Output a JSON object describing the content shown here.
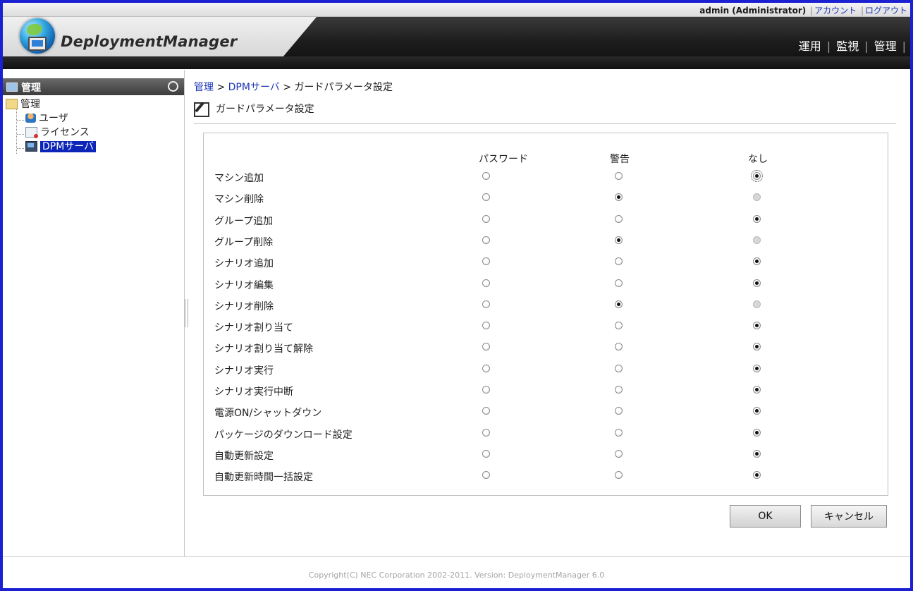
{
  "header": {
    "user": "admin (Administrator)",
    "links": [
      "アカウント",
      "ログアウト"
    ],
    "logo_text": "DeploymentManager",
    "nav": [
      "運用",
      "監視",
      "管理"
    ]
  },
  "sidebar": {
    "title": "管理",
    "tree": [
      {
        "label": "管理"
      },
      {
        "label": "ユーザ"
      },
      {
        "label": "ライセンス"
      },
      {
        "label": "DPMサーバ",
        "selected": true
      }
    ]
  },
  "breadcrumb": {
    "items": [
      "管理",
      "DPMサーバ"
    ],
    "separator": ">",
    "current": "ガードパラメータ設定"
  },
  "page_title": "ガードパラメータ設定",
  "form": {
    "columns": [
      "パスワード",
      "警告",
      "なし"
    ],
    "rows": [
      {
        "label": "マシン追加",
        "selected": "なし"
      },
      {
        "label": "マシン削除",
        "selected": "警告",
        "none_disabled": true
      },
      {
        "label": "グループ追加",
        "selected": "なし"
      },
      {
        "label": "グループ削除",
        "selected": "警告",
        "none_disabled": true
      },
      {
        "label": "シナリオ追加",
        "selected": "なし"
      },
      {
        "label": "シナリオ編集",
        "selected": "なし"
      },
      {
        "label": "シナリオ削除",
        "selected": "警告",
        "none_disabled": true
      },
      {
        "label": "シナリオ割り当て",
        "selected": "なし"
      },
      {
        "label": "シナリオ割り当て解除",
        "selected": "なし"
      },
      {
        "label": "シナリオ実行",
        "selected": "なし"
      },
      {
        "label": "シナリオ実行中断",
        "selected": "なし"
      },
      {
        "label": "電源ON/シャットダウン",
        "selected": "なし"
      },
      {
        "label": "パッケージのダウンロード設定",
        "selected": "なし"
      },
      {
        "label": "自動更新設定",
        "selected": "なし"
      },
      {
        "label": "自動更新時間一括設定",
        "selected": "なし"
      }
    ]
  },
  "buttons": {
    "ok": "OK",
    "cancel": "キャンセル"
  },
  "footer": "Copyright(C) NEC Corporation 2002-2011. Version: DeploymentManager 6.0",
  "colors": {
    "frame": "#1b20d0",
    "selected_bg": "#0c24b7",
    "link": "#1b35b5"
  }
}
